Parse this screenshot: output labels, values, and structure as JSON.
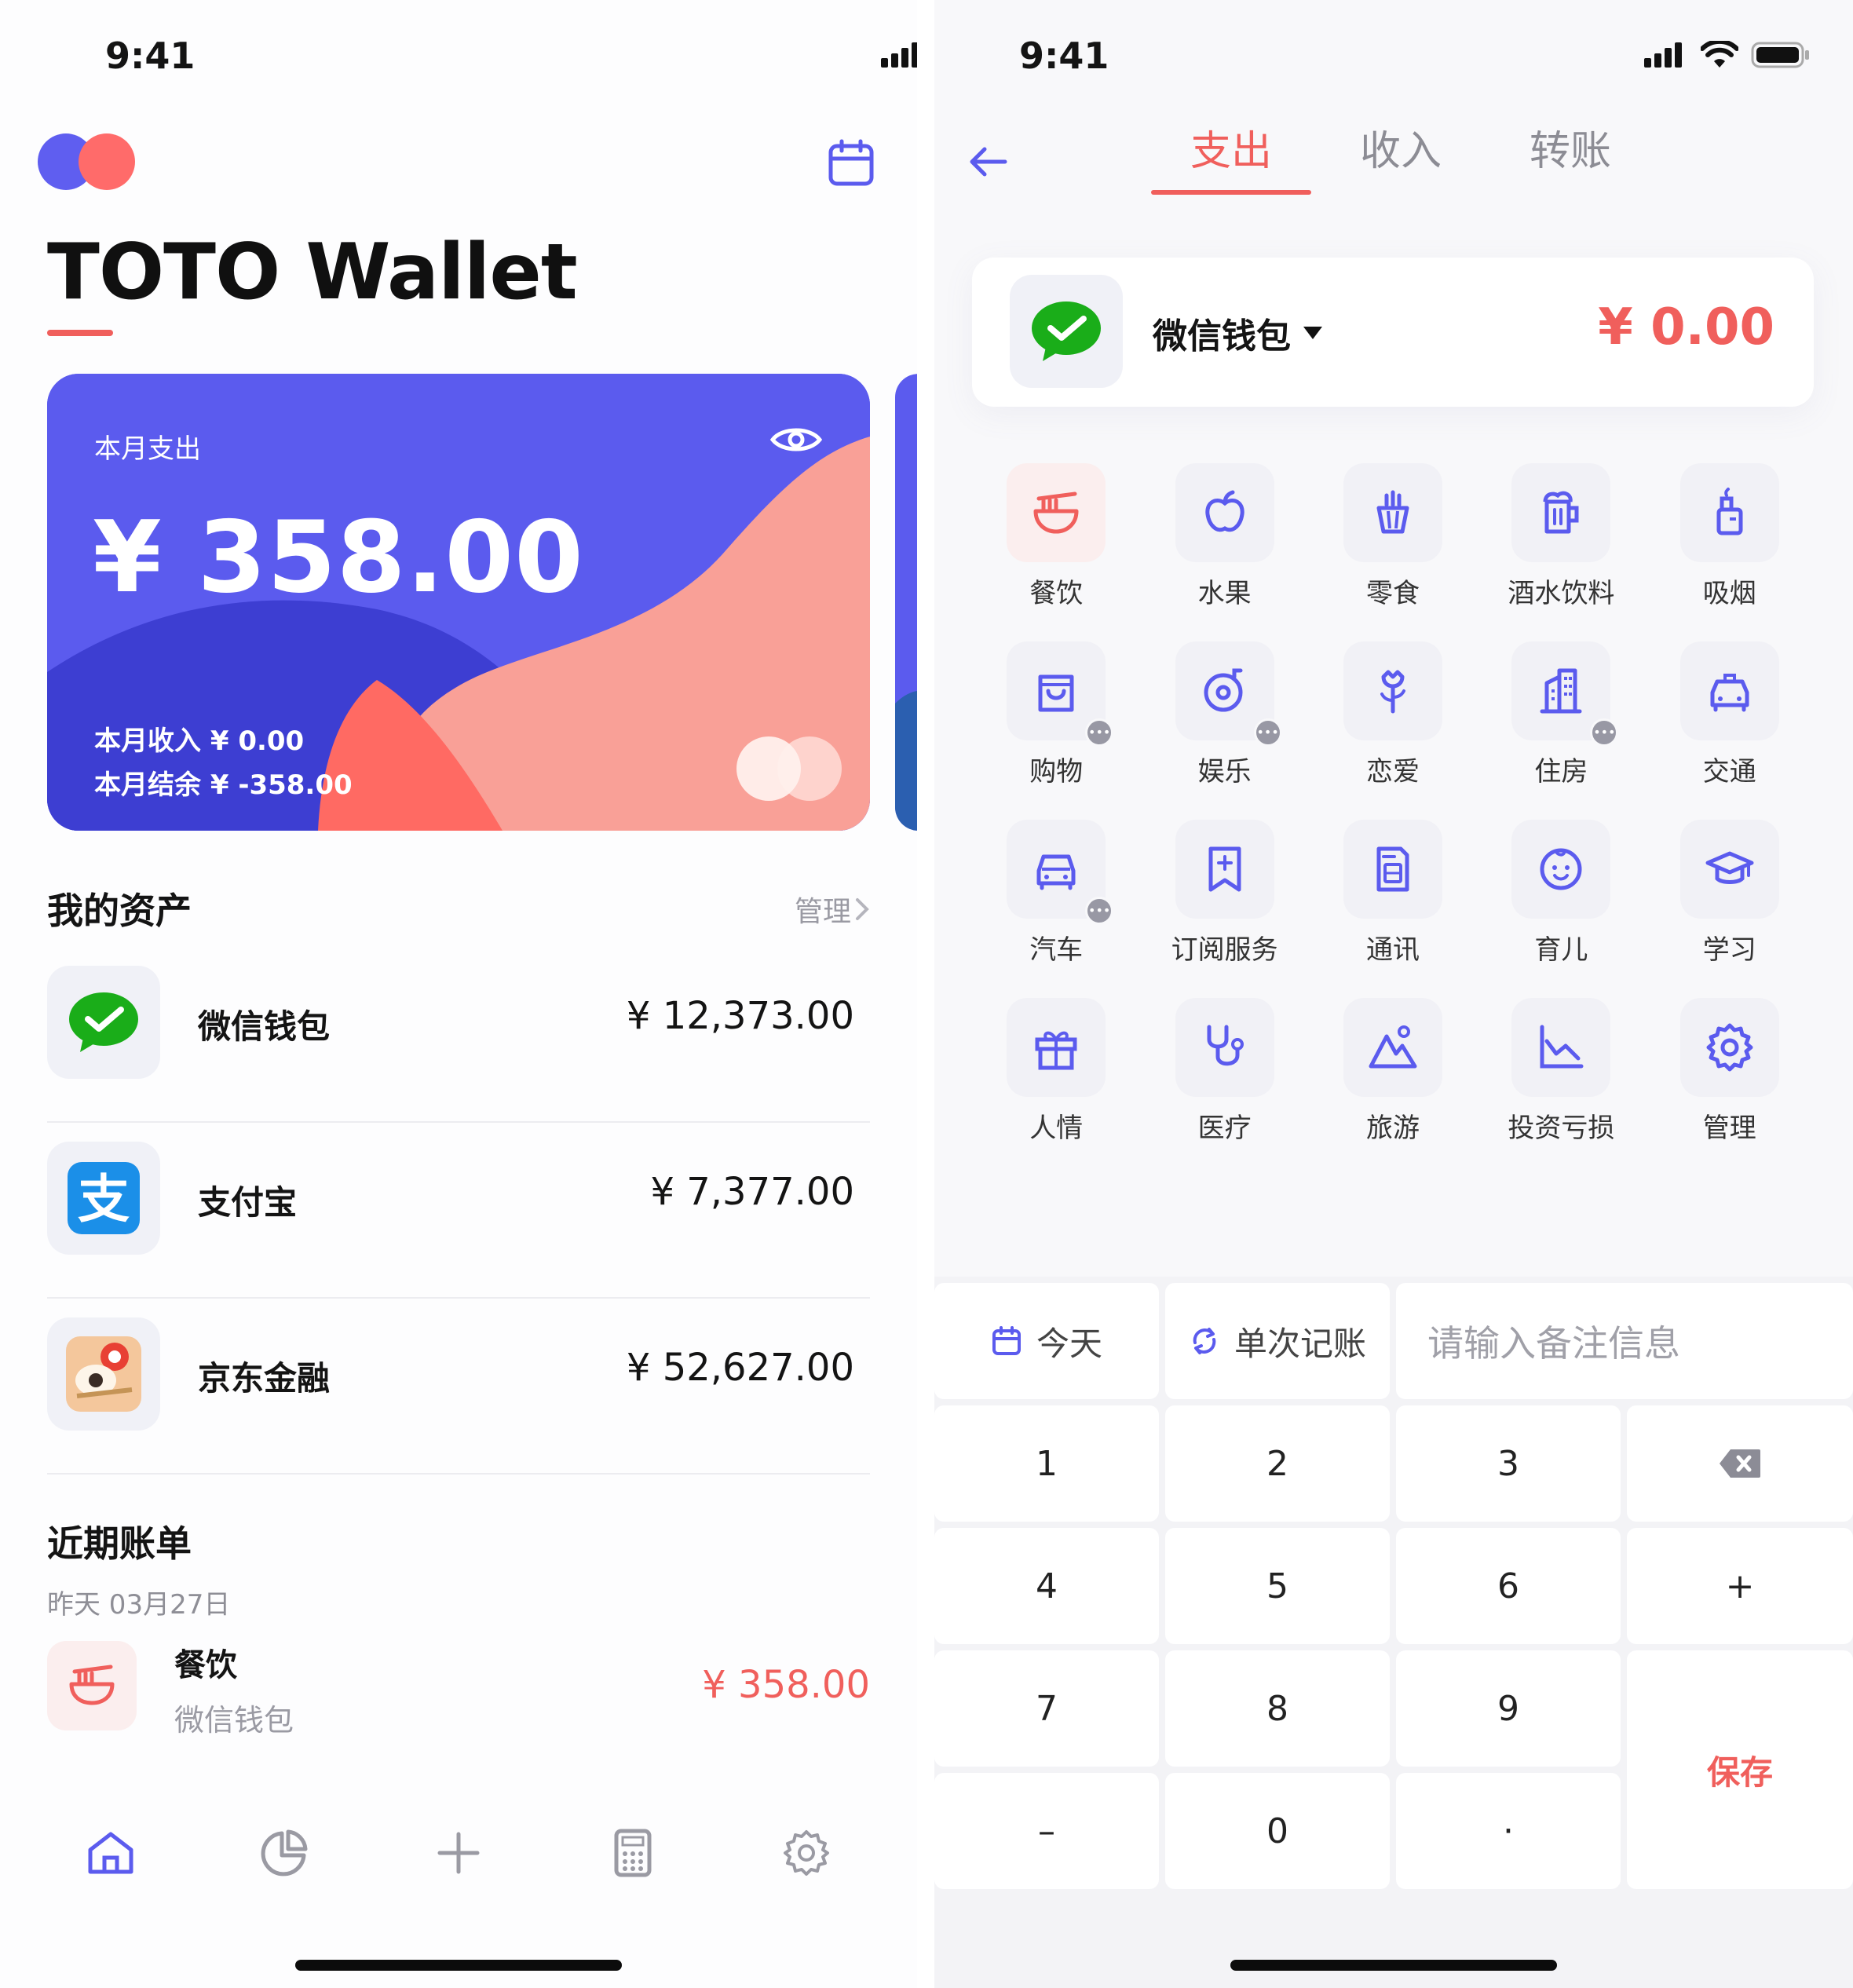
{
  "status_bar": {
    "time_left": "9:41",
    "time_right": "9:41"
  },
  "home": {
    "title": "TOTO Wallet",
    "card": {
      "label": "本月支出",
      "amount": "¥ 358.00",
      "income": "本月收入 ¥ 0.00",
      "balance": "本月结余 ¥ -358.00"
    },
    "assets_title": "我的资产",
    "manage_label": "管理",
    "assets": [
      {
        "name": "微信钱包",
        "value": "¥ 12,373.00",
        "icon": "wechat-icon"
      },
      {
        "name": "支付宝",
        "value": "¥ 7,377.00",
        "icon": "alipay-icon"
      },
      {
        "name": "京东金融",
        "value": "¥ 52,627.00",
        "icon": "jd-finance-icon"
      }
    ],
    "bills_title": "近期账单",
    "bill_date": "昨天 03月27日",
    "bill": {
      "category": "餐饮",
      "account": "微信钱包",
      "amount": "¥ 358.00"
    },
    "tabbar": [
      "home-icon",
      "chart-pie-icon",
      "plus-icon",
      "calculator-icon",
      "gear-icon"
    ]
  },
  "entry": {
    "tabs": [
      "支出",
      "收入",
      "转账"
    ],
    "active_tab": 0,
    "account": {
      "name": "微信钱包",
      "amount": "¥  0.00"
    },
    "categories": [
      {
        "label": "餐饮",
        "icon": "noodle-bowl-icon",
        "more": false,
        "selected": true
      },
      {
        "label": "水果",
        "icon": "apple-icon",
        "more": false
      },
      {
        "label": "零食",
        "icon": "popcorn-icon",
        "more": false
      },
      {
        "label": "酒水饮料",
        "icon": "beer-icon",
        "more": false
      },
      {
        "label": "吸烟",
        "icon": "lighter-icon",
        "more": false
      },
      {
        "label": "购物",
        "icon": "shopping-bag-icon",
        "more": true
      },
      {
        "label": "娱乐",
        "icon": "music-disc-icon",
        "more": true
      },
      {
        "label": "恋爱",
        "icon": "rose-icon",
        "more": false
      },
      {
        "label": "住房",
        "icon": "building-icon",
        "more": true
      },
      {
        "label": "交通",
        "icon": "taxi-icon",
        "more": false
      },
      {
        "label": "汽车",
        "icon": "car-icon",
        "more": true
      },
      {
        "label": "订阅服务",
        "icon": "bookmark-plus-icon",
        "more": false
      },
      {
        "label": "通讯",
        "icon": "sim-card-icon",
        "more": false
      },
      {
        "label": "育儿",
        "icon": "baby-face-icon",
        "more": false
      },
      {
        "label": "学习",
        "icon": "graduation-cap-icon",
        "more": false
      },
      {
        "label": "人情",
        "icon": "gift-icon",
        "more": false
      },
      {
        "label": "医疗",
        "icon": "stethoscope-icon",
        "more": false
      },
      {
        "label": "旅游",
        "icon": "mountain-icon",
        "more": false
      },
      {
        "label": "投资亏损",
        "icon": "line-chart-icon",
        "more": false
      },
      {
        "label": "管理",
        "icon": "gear-icon",
        "more": false
      }
    ],
    "keypad": {
      "date_label": "今天",
      "repeat_label": "单次记账",
      "memo_placeholder": "请输入备注信息",
      "keys": [
        "1",
        "2",
        "3",
        "4",
        "5",
        "6",
        "7",
        "8",
        "9",
        "–",
        "0",
        "·",
        "+"
      ],
      "save_label": "保存"
    }
  },
  "colors": {
    "accent": "#5b5bee",
    "red": "#f05f5c",
    "text": "#141414"
  }
}
